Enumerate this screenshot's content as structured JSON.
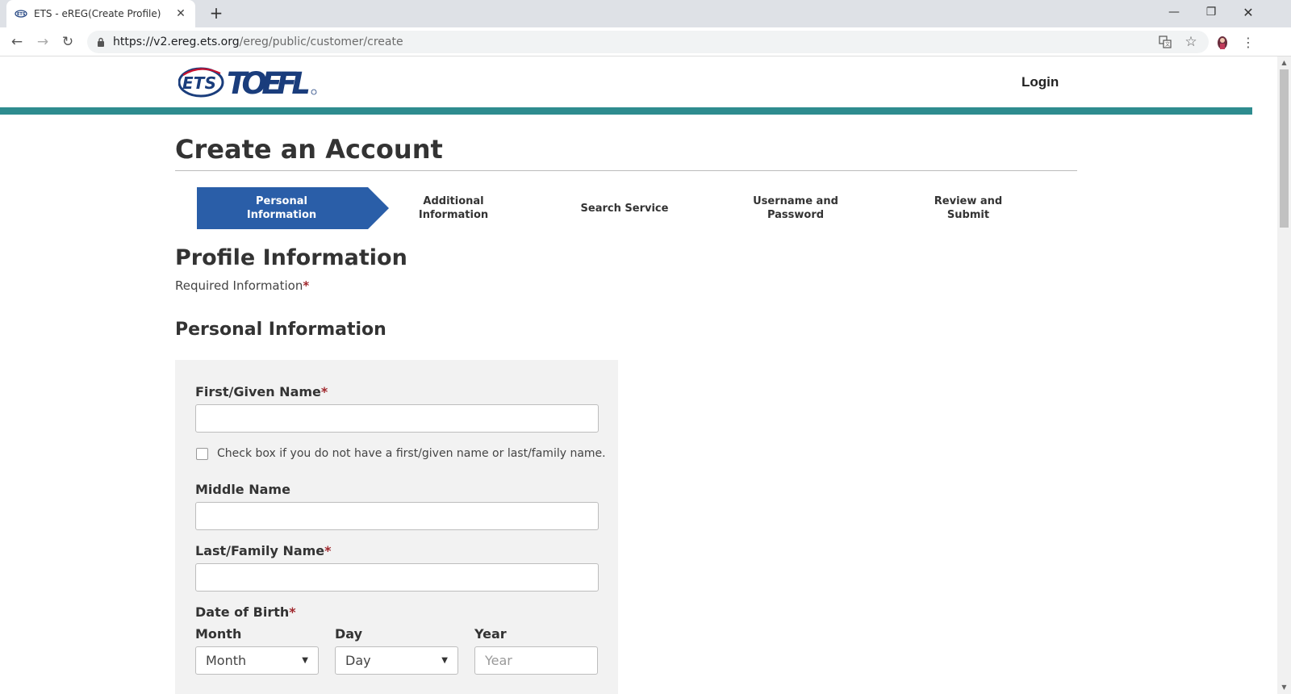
{
  "browser": {
    "tab_title": "ETS - eREG(Create Profile)",
    "url_host": "https://v2.ereg.ets.org",
    "url_path": "/ereg/public/customer/create"
  },
  "header": {
    "logo_ets": "ETS",
    "logo_toefl": "TOEFL",
    "logo_reg": "®",
    "login_label": "Login"
  },
  "page_title": "Create an Account",
  "steps": [
    {
      "label": "Personal Information",
      "active": true
    },
    {
      "label": "Additional Information",
      "active": false
    },
    {
      "label": "Search Service",
      "active": false
    },
    {
      "label": "Username and Password",
      "active": false
    },
    {
      "label": "Review and Submit",
      "active": false
    }
  ],
  "section_title": "Profile Information",
  "required_text": "Required Information",
  "required_marker": "*",
  "subsection_title": "Personal Information",
  "form": {
    "first_name_label": "First/Given Name",
    "first_name_value": "",
    "no_name_checkbox_label": "Check box if you do not have a first/given name or last/family name.",
    "middle_name_label": "Middle Name",
    "middle_name_value": "",
    "last_name_label": "Last/Family Name",
    "last_name_value": "",
    "dob_label": "Date of Birth",
    "month_label": "Month",
    "month_value": "Month",
    "day_label": "Day",
    "day_value": "Day",
    "year_label": "Year",
    "year_placeholder": "Year"
  },
  "colors": {
    "teal_bar": "#2e8c8f",
    "active_step": "#2a5ea8",
    "required_asterisk": "#a0282d",
    "logo_navy": "#1a3d7c",
    "logo_red": "#c8102e"
  }
}
